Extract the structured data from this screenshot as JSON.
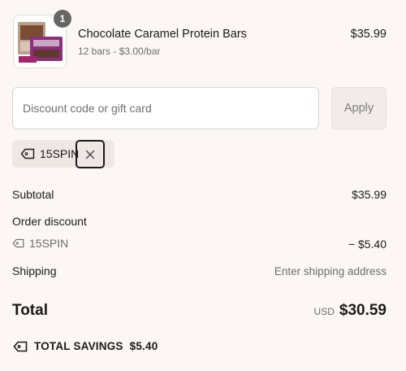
{
  "product": {
    "quantity": "1",
    "name": "Chocolate Caramel Protein Bars",
    "variant": "12 bars - $3.00/bar",
    "price": "$35.99",
    "image_icon": "product-thumbnail-icon"
  },
  "discount": {
    "placeholder": "Discount code or gift card",
    "value": "",
    "apply_label": "Apply",
    "applied_code": "15SPIN"
  },
  "summary": {
    "subtotal_label": "Subtotal",
    "subtotal_value": "$35.99",
    "order_discount_label": "Order discount",
    "discount_code": "15SPIN",
    "discount_value": "− $5.40",
    "shipping_label": "Shipping",
    "shipping_value": "Enter shipping address",
    "total_label": "Total",
    "currency": "USD",
    "total_value": "$30.59",
    "savings_label": "TOTAL SAVINGS",
    "savings_value": "$5.40"
  },
  "colors": {
    "background": "#fcf7f5",
    "badge": "#666666",
    "tag_bg": "#efe7e4"
  }
}
